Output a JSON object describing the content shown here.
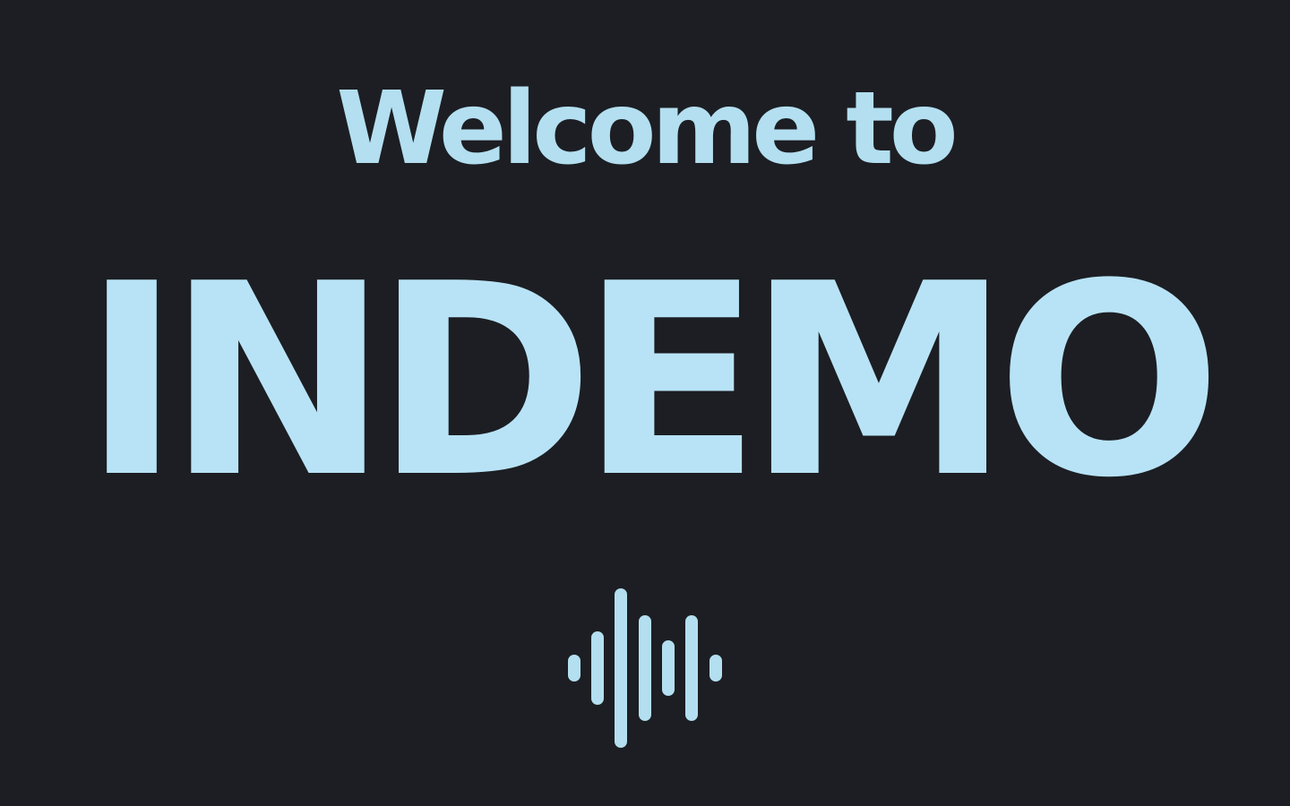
{
  "hero": {
    "greeting": "Welcome to",
    "brand_name": "INDEMO"
  },
  "logo": {
    "icon": "audio-waveform-icon"
  },
  "colors": {
    "background": "#1c1e23",
    "accent": "#b8e3f6"
  }
}
